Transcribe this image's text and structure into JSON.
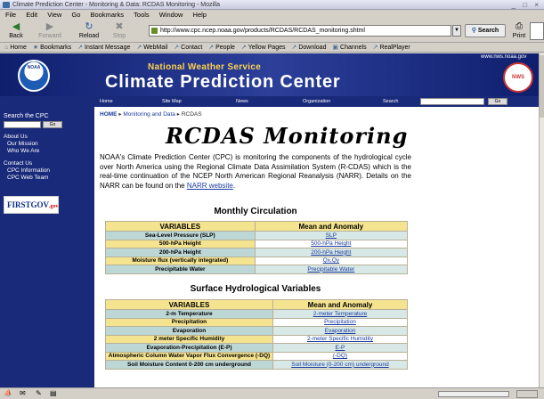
{
  "window": {
    "title": "Climate Prediction Center - Monitoring & Data: RCDAS Monitoring - Mozilla",
    "controls": "_ □ ×"
  },
  "menu": [
    "File",
    "Edit",
    "View",
    "Go",
    "Bookmarks",
    "Tools",
    "Window",
    "Help"
  ],
  "nav": {
    "back": "Back",
    "forward": "Forward",
    "reload": "Reload",
    "stop": "Stop",
    "url": "http://www.cpc.ncep.noaa.gov/products/RCDAS/RCDAS_monitoring.shtml",
    "search": "Search",
    "print": "Print"
  },
  "bookmarks": [
    "Home",
    "Bookmarks",
    "Instant Message",
    "WebMail",
    "Contact",
    "People",
    "Yellow Pages",
    "Download",
    "Channels",
    "RealPlayer"
  ],
  "banner": {
    "agency": "National Weather Service",
    "title": "Climate Prediction Center",
    "nws_url": "www.nws.noaa.gov",
    "noaa_logo": "NOAA",
    "nws_logo": "NWS"
  },
  "topnav": {
    "home": "Home",
    "sitemap": "Site Map",
    "news": "News",
    "organization": "Organization",
    "search": "Search",
    "go": "Go"
  },
  "sidebar": {
    "search_label": "Search the CPC",
    "go": "Go",
    "about_heading": "About Us",
    "about_links": [
      "Our Mission",
      "Who We Are"
    ],
    "contact_heading": "Contact Us",
    "contact_links": [
      "CPC Information",
      "CPC Web Team"
    ],
    "firstgov": "FIRSTGOV",
    "firstgov_suffix": ".gov"
  },
  "breadcrumb": {
    "home": "HOME",
    "section": "Monitoring and Data",
    "current": "RCDAS"
  },
  "page_title": "RCDAS Monitoring",
  "intro": {
    "text": "NOAA's Climate Prediction Center (CPC) is monitoring the components of the hydrological cycle over North America using the Regional Climate Data Assimilation System (R-CDAS) which is the real-time continuation of the NCEP North American Regional Reanalysis (NARR). Details on the NARR can be found on the ",
    "link": "NARR website",
    "end": "."
  },
  "monthly": {
    "heading": "Monthly Circulation",
    "col_var": "VARIABLES",
    "col_val": "Mean and Anomaly",
    "rows": [
      {
        "var": "Sea-Level Pressure (SLP)",
        "val": "SLP",
        "teal": true
      },
      {
        "var": "500-hPa Height",
        "val": "500-hPa Height",
        "teal": false
      },
      {
        "var": "200-hPa Height",
        "val": "200-hPa Height",
        "teal": true
      },
      {
        "var": "Moisture flux (vertically integrated)",
        "val": "Qx,Qy",
        "teal": false
      },
      {
        "var": "Precipitable Water",
        "val": "Precipitable Water",
        "teal": true
      }
    ]
  },
  "surface": {
    "heading": "Surface Hydrological Variables",
    "col_var": "VARIABLES",
    "col_val": "Mean and Anomaly",
    "rows": [
      {
        "var": "2-m Temperature",
        "val": "2-meter Temperature",
        "teal": true
      },
      {
        "var": "Precipitation",
        "val": "Precipitation",
        "teal": false
      },
      {
        "var": "Evaporation",
        "val": "Evaporation",
        "teal": true
      },
      {
        "var": "2 meter Specific Humidity",
        "val": "2-meter Specific Humidity",
        "teal": false
      },
      {
        "var": "Evaporation-Precipitation (E-P)",
        "val": "E-P",
        "teal": true
      },
      {
        "var": "Atmospheric Column Water Vapor Flux Convergence (-DQ)",
        "val": "(-DQ)",
        "teal": false
      },
      {
        "var": "Soil Moisture Content 0-200 cm underground",
        "val": "Soil Moisture (0-200 cm) underground",
        "teal": true
      }
    ]
  },
  "status": {
    "done": ""
  }
}
